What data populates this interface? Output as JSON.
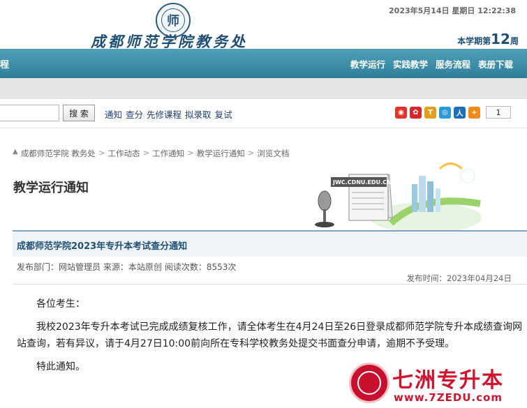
{
  "header": {
    "emblem_text": "师",
    "site_name": "成都师范学院教务处",
    "datetime": "2023年5月14日 星期日 12:22:38",
    "week_prefix": "本学期第",
    "week_num": "12",
    "week_suffix": "周"
  },
  "nav": {
    "left_label": "程",
    "items": [
      "教学运行",
      "实践教学",
      "服务流程",
      "表册下载"
    ]
  },
  "toolbar": {
    "search_value": "",
    "search_button": "搜 索",
    "hot_links": [
      "通知",
      "查分",
      "先修课程",
      "拟录取",
      "复试"
    ],
    "share_count": "1"
  },
  "breadcrumb": [
    "成都师范学院 教务处",
    "工作动态",
    "工作通知",
    "教学运行通知",
    "浏览文档"
  ],
  "page_title": "教学运行通知",
  "illustration": {
    "sign_text": "JWC.CDNU.EDU.CN"
  },
  "article": {
    "title": "成都师范学院2023年专升本考试查分通知",
    "meta_dept": "发布部门：网站管理员 来源：本站原创",
    "meta_views": "阅读次数：8553次",
    "pubtime": "发布时间：2023年04月24日",
    "greeting": "各位考生：",
    "paragraph": "我校2023年专升本考试已完成成绩复核工作，请全体考生在4月24日至26日登录成都师范学院专升本成绩查询网站查询，若有异议，请于4月27日10:00前向所在专科学校教务处提交书面查分申请，逾期不予受理。",
    "closing": "特此通知。"
  },
  "watermark": {
    "name": "七洲专升本",
    "url": "www.7ZEDU.com"
  },
  "colors": {
    "nav_bg": "#3d8fa9",
    "title_blue": "#1f4f73",
    "watermark_red": "#d0142f"
  }
}
